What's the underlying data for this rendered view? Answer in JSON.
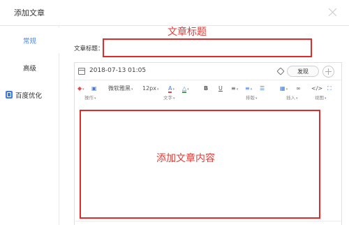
{
  "dialog": {
    "title": "添加文章"
  },
  "sidebar": {
    "items": [
      {
        "label": "常规"
      },
      {
        "label": "高级"
      },
      {
        "label": "百度优化"
      }
    ]
  },
  "annotations": {
    "title_note": "文章标题",
    "content_note": "添加文章内容"
  },
  "form": {
    "title_label": "文章标题：",
    "title_value": ""
  },
  "editor": {
    "date": "2018-07-13 01:05",
    "publish_label": "发现",
    "toolbar": {
      "font_family": "微软雅黑",
      "font_size": "12px",
      "bold": "B",
      "underline": "U",
      "code": "</>",
      "groups": {
        "operation": "操作",
        "text": "文字",
        "layout": "排版",
        "insert": "插入",
        "view": "视图"
      }
    }
  },
  "colors": {
    "accent": "#4a86e8",
    "annotation_red": "#e02b28"
  }
}
